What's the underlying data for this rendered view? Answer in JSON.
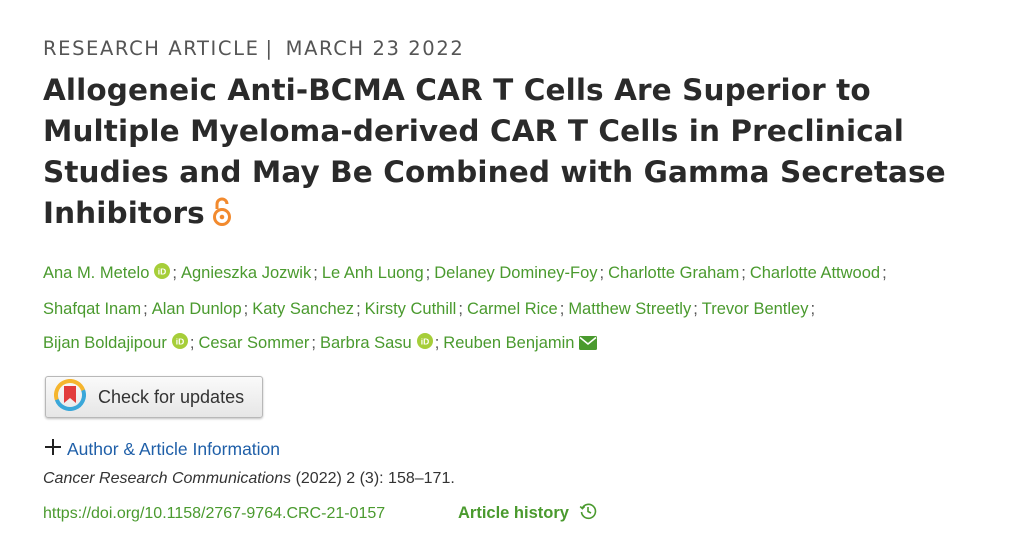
{
  "header": {
    "article_type": "RESEARCH ARTICLE",
    "separator": "|",
    "date": "MARCH 23 2022"
  },
  "article": {
    "title": "Allogeneic Anti-BCMA CAR T Cells Are Superior to Multiple Myeloma-derived CAR T Cells in Preclinical Studies and May Be Combined with Gamma Secretase Inhibitors",
    "open_access_icon": "open-access-lock-icon"
  },
  "authors": [
    {
      "name": "Ana M. Metelo",
      "orcid": true
    },
    {
      "name": "Agnieszka Jozwik"
    },
    {
      "name": "Le Anh Luong"
    },
    {
      "name": "Delaney Dominey-Foy"
    },
    {
      "name": "Charlotte Graham"
    },
    {
      "name": "Charlotte Attwood"
    },
    {
      "name": "Shafqat Inam"
    },
    {
      "name": "Alan Dunlop"
    },
    {
      "name": "Katy Sanchez"
    },
    {
      "name": "Kirsty Cuthill"
    },
    {
      "name": "Carmel Rice"
    },
    {
      "name": "Matthew Streetly"
    },
    {
      "name": "Trevor Bentley"
    },
    {
      "name": "Bijan Boldajipour",
      "orcid": true
    },
    {
      "name": "Cesar Sommer"
    },
    {
      "name": "Barbra Sasu",
      "orcid": true
    },
    {
      "name": "Reuben Benjamin",
      "email": true
    }
  ],
  "author_separator": ";",
  "actions": {
    "check_updates_label": "Check for updates",
    "author_info_label": "Author & Article Information",
    "article_history_label": "Article history"
  },
  "citation": {
    "journal": "Cancer Research Communications",
    "details": "(2022) 2 (3): 158–171."
  },
  "doi": "https://doi.org/10.1158/2767-9764.CRC-21-0157",
  "colors": {
    "link_green": "#4a9a2e",
    "link_blue": "#1f5fa8",
    "open_access_orange": "#f28a2e"
  }
}
